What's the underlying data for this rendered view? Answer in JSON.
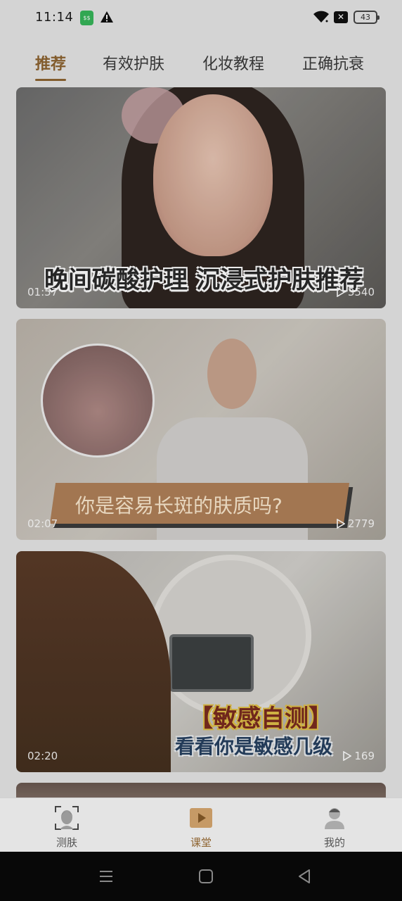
{
  "status_bar": {
    "time": "11:14",
    "sim_label": "$$",
    "battery": "43"
  },
  "tabs": [
    {
      "label": "推荐",
      "active": true
    },
    {
      "label": "有效护肤",
      "active": false
    },
    {
      "label": "化妆教程",
      "active": false
    },
    {
      "label": "正确抗衰",
      "active": false
    }
  ],
  "videos": [
    {
      "caption": "晚间碳酸护理 沉浸式护肤推荐",
      "duration": "01:57",
      "views": "3540"
    },
    {
      "caption": "你是容易长斑的肤质吗?",
      "duration": "02:07",
      "views": "2779"
    },
    {
      "caption_line1": "【敏感自测】",
      "caption_line2": "看看你是敏感几级",
      "duration": "02:20",
      "views": "169"
    }
  ],
  "bottom_nav": [
    {
      "label": "测肤",
      "icon": "face-scan-icon",
      "active": false
    },
    {
      "label": "课堂",
      "icon": "play-video-icon",
      "active": true
    },
    {
      "label": "我的",
      "icon": "profile-icon",
      "active": false
    }
  ],
  "colors": {
    "accent": "#8e6431",
    "background": "#e6e6e6"
  }
}
